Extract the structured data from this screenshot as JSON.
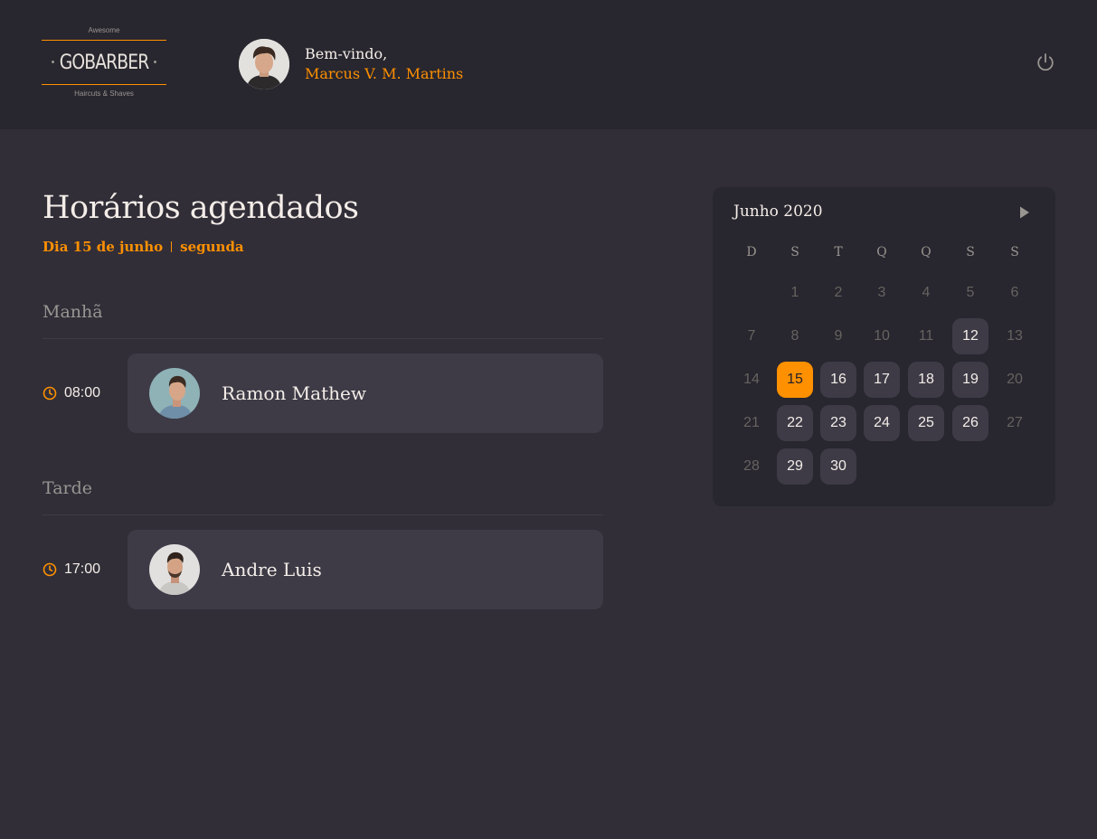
{
  "header": {
    "logo": {
      "top_text": "Awesome",
      "word": "GOBARBER",
      "bottom_text": "Haircuts & Shaves"
    },
    "welcome_text": "Bem-vindo,",
    "user_name": "Marcus V. M. Martins",
    "power_icon": "power-icon"
  },
  "main": {
    "title": "Horários agendados",
    "day_text": "Dia 15 de junho",
    "weekday_text": "segunda",
    "sections": [
      {
        "title": "Manhã",
        "appointments": [
          {
            "time": "08:00",
            "name": "Ramon Mathew"
          }
        ]
      },
      {
        "title": "Tarde",
        "appointments": [
          {
            "time": "17:00",
            "name": "Andre Luis"
          }
        ]
      }
    ]
  },
  "calendar": {
    "month_label": "Junho 2020",
    "next_icon": "triangle-right-icon",
    "weekdays": [
      "D",
      "S",
      "T",
      "Q",
      "Q",
      "S",
      "S"
    ],
    "days": [
      "1",
      "2",
      "3",
      "4",
      "5",
      "6",
      "7",
      "8",
      "9",
      "10",
      "11",
      "12",
      "13",
      "14",
      "15",
      "16",
      "17",
      "18",
      "19",
      "20",
      "21",
      "22",
      "23",
      "24",
      "25",
      "26",
      "27",
      "28",
      "29",
      "30"
    ],
    "available_days": [
      "12",
      "16",
      "17",
      "18",
      "19",
      "22",
      "23",
      "24",
      "25",
      "26",
      "29",
      "30"
    ],
    "selected_day": "15"
  },
  "colors": {
    "accent": "#ff9000",
    "background": "#312e38",
    "header_bg": "#28262e",
    "card_bg": "#3e3b47",
    "muted_text": "#999591"
  }
}
